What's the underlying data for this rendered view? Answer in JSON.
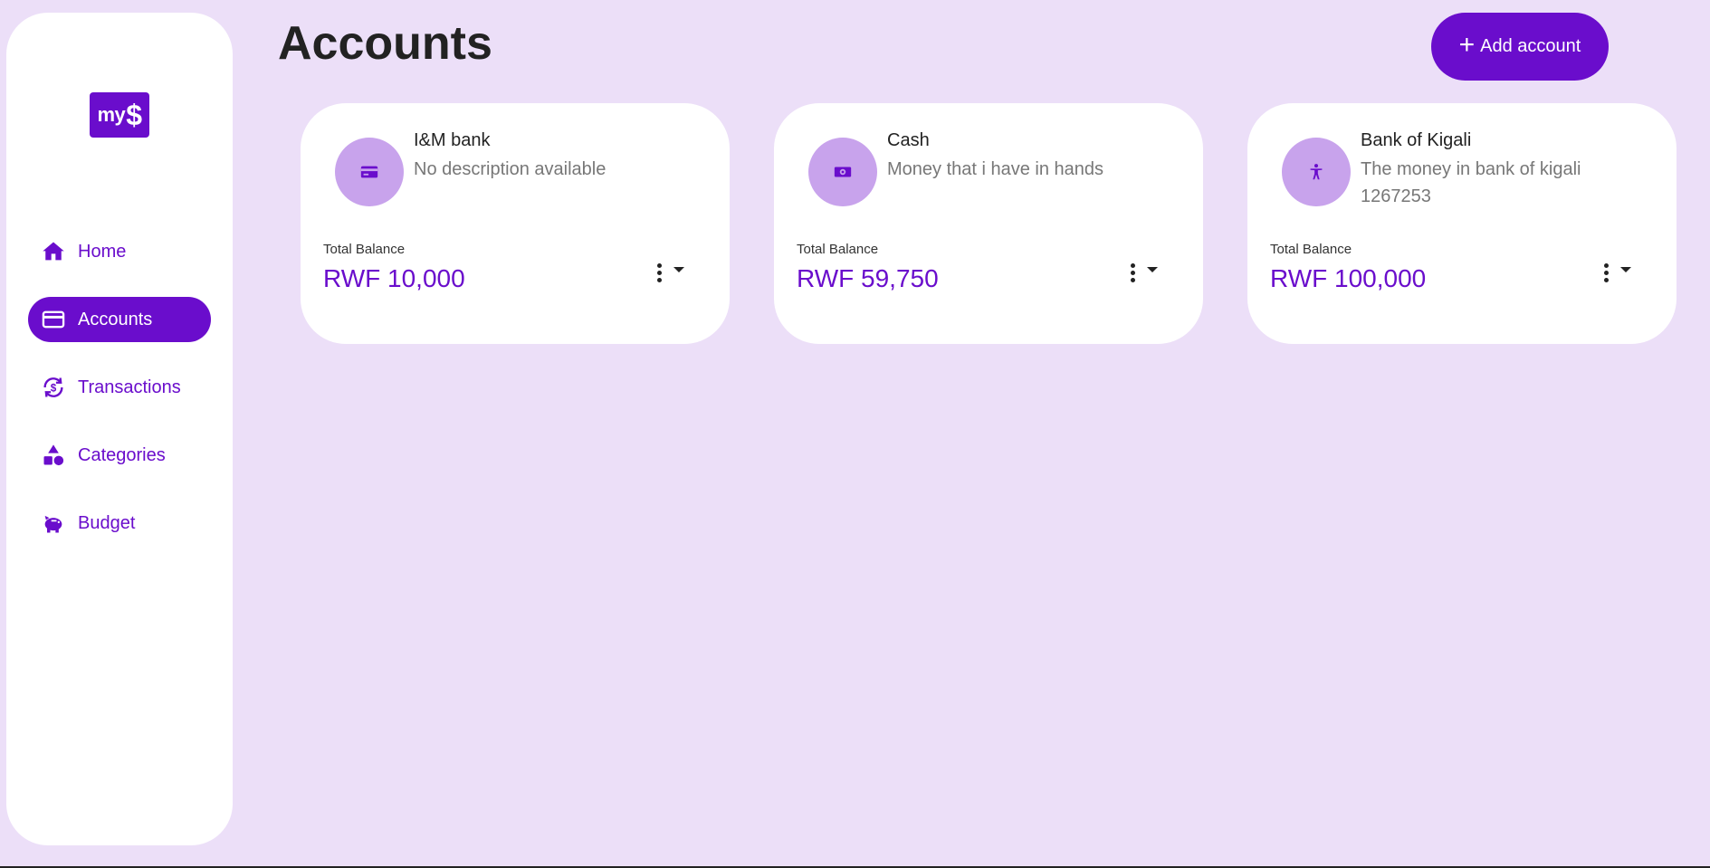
{
  "sidebar": {
    "logo": {
      "text": "my",
      "symbol": "$"
    },
    "items": [
      {
        "label": "Home",
        "icon": "home-icon",
        "active": false
      },
      {
        "label": "Accounts",
        "icon": "card-icon",
        "active": true
      },
      {
        "label": "Transactions",
        "icon": "transactions-icon",
        "active": false
      },
      {
        "label": "Categories",
        "icon": "shapes-icon",
        "active": false
      },
      {
        "label": "Budget",
        "icon": "piggy-bank-icon",
        "active": false
      }
    ]
  },
  "header": {
    "title": "Accounts",
    "add_button": {
      "plus": "+",
      "label": "Add account"
    }
  },
  "accounts": [
    {
      "name": "I&M bank",
      "description": "No description available",
      "balance_label": "Total Balance",
      "balance": "RWF 10,000",
      "icon": "credit-card-icon"
    },
    {
      "name": "Cash",
      "description": "Money that i have in hands",
      "balance_label": "Total Balance",
      "balance": "RWF 59,750",
      "icon": "money-bill-icon"
    },
    {
      "name": "Bank of Kigali",
      "description": "The money in bank of kigali 1267253",
      "balance_label": "Total Balance",
      "balance": "RWF 100,000",
      "icon": "person-icon"
    }
  ],
  "colors": {
    "accent": "#6a0dcc",
    "background": "#ecdff8",
    "icon_circle": "#c8a3ec"
  }
}
